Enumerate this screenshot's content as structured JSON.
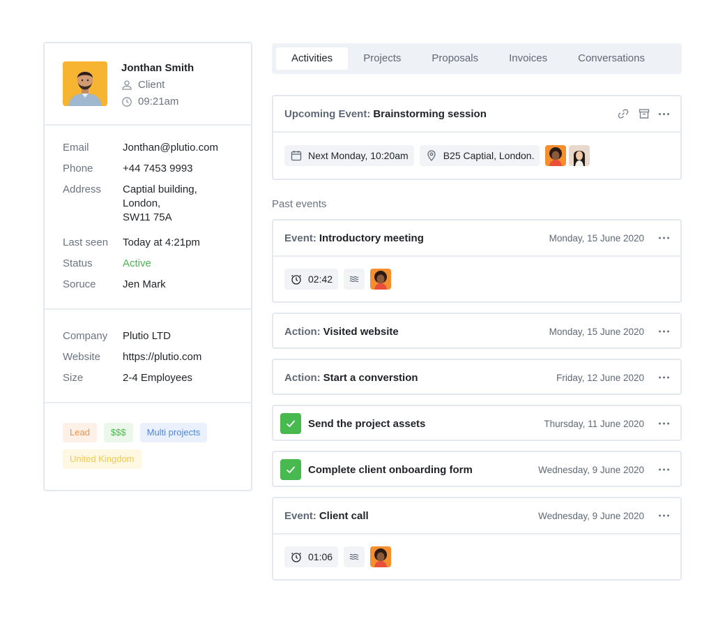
{
  "profile": {
    "name": "Jonthan Smith",
    "role": "Client",
    "time": "09:21am"
  },
  "contact": {
    "email_label": "Email",
    "email": "Jonthan@plutio.com",
    "phone_label": "Phone",
    "phone": "+44 7453 9993",
    "address_label": "Address",
    "address": "Captial building,\nLondon,\nSW11 75A",
    "last_seen_label": "Last seen",
    "last_seen": "Today at 4:21pm",
    "status_label": "Status",
    "status": "Active",
    "source_label": "Soruce",
    "source": "Jen Mark"
  },
  "company": {
    "company_label": "Company",
    "company": "Plutio LTD",
    "website_label": "Website",
    "website": "https://plutio.com",
    "size_label": "Size",
    "size": "2-4 Employees"
  },
  "tags": [
    "Lead",
    "$$$",
    "Multi projects",
    "United Kingdom"
  ],
  "colors": {
    "active": "#47b84d",
    "check": "#48b94e",
    "accent_bg": "#eef1f6"
  },
  "tabs": [
    "Activities",
    "Projects",
    "Proposals",
    "Invoices",
    "Conversations"
  ],
  "upcoming": {
    "kind": "Upcoming Event:",
    "title": "Brainstorming session",
    "date": "Next Monday, 10:20am",
    "location": "B25 Captial, London.",
    "icons": [
      "link-icon",
      "archive-icon",
      "more-icon"
    ]
  },
  "past_label": "Past events",
  "past": [
    {
      "kind": "Event:",
      "title": "Introductory meeting",
      "date": "Monday, 15 June 2020",
      "duration": "02:42"
    },
    {
      "kind": "Action:",
      "title": "Visited website",
      "date": "Monday, 15 June 2020"
    },
    {
      "kind": "Action:",
      "title": "Start a converstion",
      "date": "Friday, 12 June 2020"
    },
    {
      "kind": "",
      "title": "Send the project assets",
      "date": "Thursday, 11 June 2020"
    },
    {
      "kind": "",
      "title": "Complete client onboarding form",
      "date": "Wednesday, 9 June 2020"
    },
    {
      "kind": "Event:",
      "title": "Client call",
      "date": "Wednesday, 9 June 2020",
      "duration": "01:06"
    }
  ]
}
